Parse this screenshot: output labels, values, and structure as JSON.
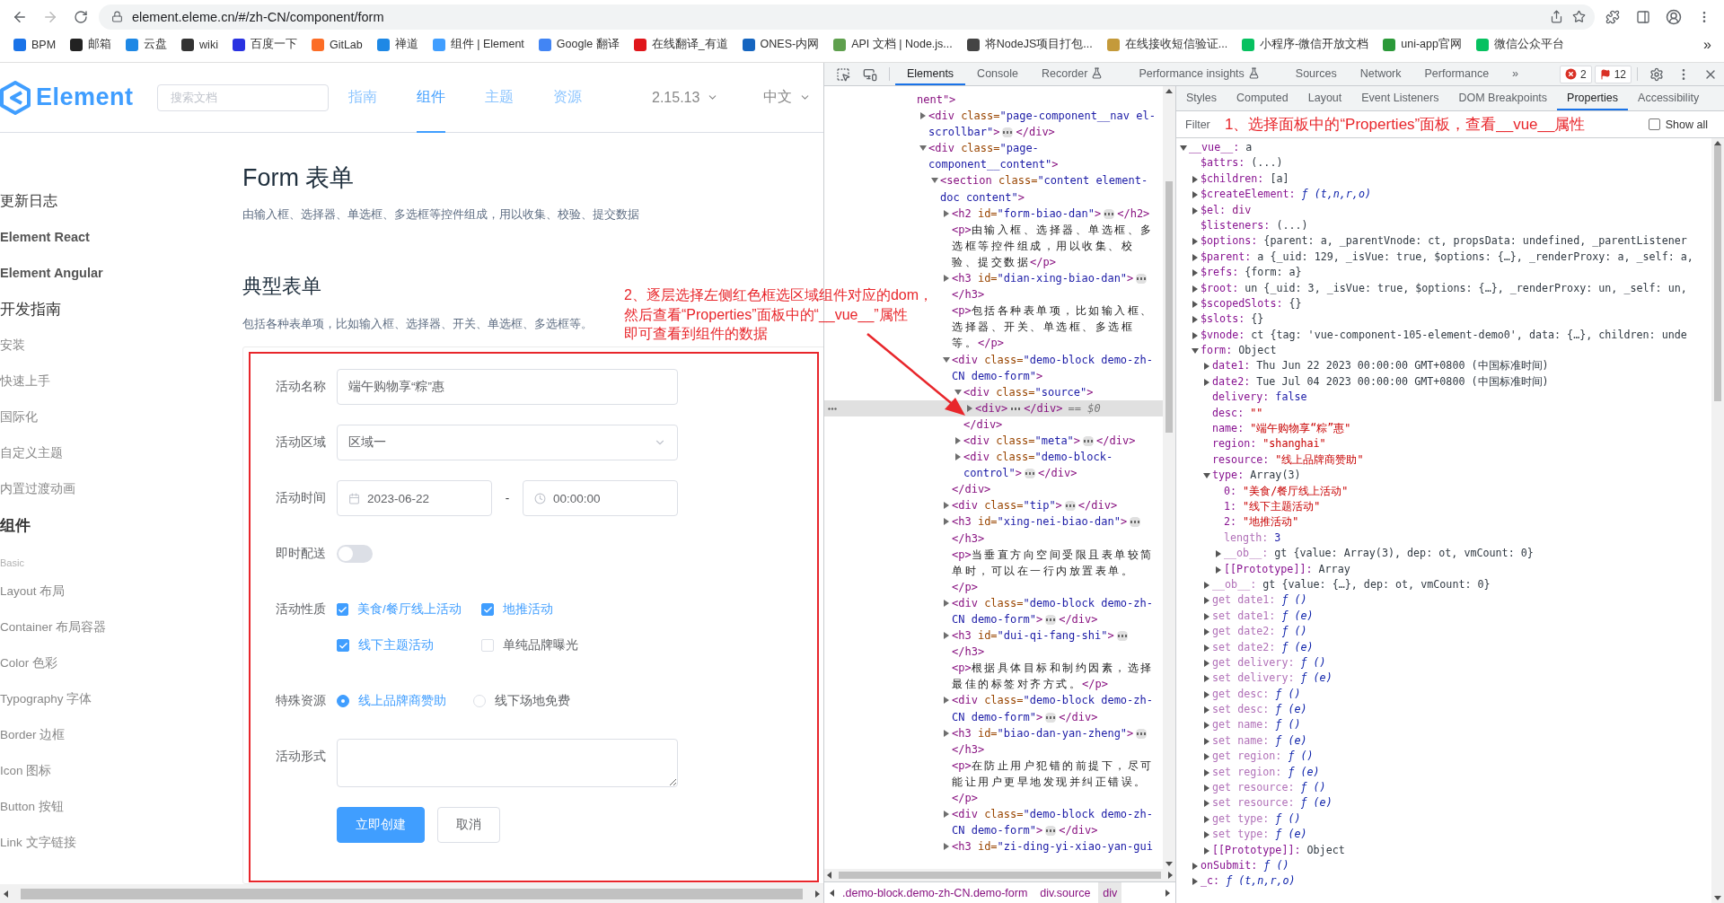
{
  "browser": {
    "url": "element.eleme.cn/#/zh-CN/component/form",
    "bookmarks": [
      {
        "label": "BPM",
        "color": "#1a73e8"
      },
      {
        "label": "邮箱",
        "color": "#222222"
      },
      {
        "label": "云盘",
        "color": "#1e88e5"
      },
      {
        "label": "wiki",
        "color": "#333333"
      },
      {
        "label": "百度一下",
        "color": "#2932e1"
      },
      {
        "label": "GitLab",
        "color": "#fc6d26"
      },
      {
        "label": "禅道",
        "color": "#1e88e5"
      },
      {
        "label": "组件 | Element",
        "color": "#409eff"
      },
      {
        "label": "Google 翻译",
        "color": "#4285f4"
      },
      {
        "label": "在线翻译_有道",
        "color": "#e0161b"
      },
      {
        "label": "ONES-内网",
        "color": "#1565c0"
      },
      {
        "label": "API 文档 | Node.js...",
        "color": "#5fa04e"
      },
      {
        "label": "将NodeJS项目打包...",
        "color": "#444444"
      },
      {
        "label": "在线接收短信验证...",
        "color": "#c49a3a"
      },
      {
        "label": "小程序-微信开放文档",
        "color": "#07c160"
      },
      {
        "label": "uni-app官网",
        "color": "#2b9939"
      },
      {
        "label": "微信公众平台",
        "color": "#07c160"
      }
    ],
    "more": "»"
  },
  "site": {
    "logo": "Element",
    "search": {
      "placeholder": "搜索文档"
    },
    "nav": [
      {
        "label": "指南",
        "selected": false
      },
      {
        "label": "组件",
        "selected": true
      },
      {
        "label": "主题",
        "selected": false
      },
      {
        "label": "资源",
        "selected": false
      }
    ],
    "version": "2.15.13",
    "language": "中文",
    "sidebar": [
      {
        "label": "更新日志",
        "kind": "top"
      },
      {
        "label": "Element React",
        "kind": "link"
      },
      {
        "label": "Element Angular",
        "kind": "link"
      },
      {
        "label": "开发指南",
        "kind": "section"
      },
      {
        "label": "安装",
        "kind": "item"
      },
      {
        "label": "快速上手",
        "kind": "item"
      },
      {
        "label": "国际化",
        "kind": "item"
      },
      {
        "label": "自定义主题",
        "kind": "item"
      },
      {
        "label": "内置过渡动画",
        "kind": "item"
      },
      {
        "label": "组件",
        "kind": "section"
      },
      {
        "label": "Basic",
        "kind": "group"
      },
      {
        "label": "Layout 布局",
        "kind": "item"
      },
      {
        "label": "Container 布局容器",
        "kind": "item"
      },
      {
        "label": "Color 色彩",
        "kind": "item"
      },
      {
        "label": "Typography 字体",
        "kind": "item"
      },
      {
        "label": "Border 边框",
        "kind": "item"
      },
      {
        "label": "Icon 图标",
        "kind": "item"
      },
      {
        "label": "Button 按钮",
        "kind": "item"
      },
      {
        "label": "Link 文字链接",
        "kind": "item"
      }
    ],
    "title": "Form 表单",
    "description": "由输入框、选择器、单选框、多选框等控件组成，用以收集、校验、提交数据",
    "section_title": "典型表单",
    "section_description": "包括各种表单项，比如输入框、选择器、开关、单选框、多选框等。",
    "form": {
      "fields": [
        {
          "label": "活动名称",
          "kind": "input",
          "value": "端午购物享“粽”惠"
        },
        {
          "label": "活动区域",
          "kind": "select",
          "value": "区域一"
        },
        {
          "label": "活动时间",
          "kind": "datetime",
          "date": "2023-06-22",
          "separator": "-",
          "time": "00:00:00"
        },
        {
          "label": "即时配送",
          "kind": "switch",
          "on": false
        },
        {
          "label": "活动性质",
          "kind": "checkboxes",
          "options": [
            {
              "label": "美食/餐厅线上活动",
              "checked": true
            },
            {
              "label": "地推活动",
              "checked": true
            },
            {
              "label": "线下主题活动",
              "checked": true
            },
            {
              "label": "单纯品牌曝光",
              "checked": false
            }
          ]
        },
        {
          "label": "特殊资源",
          "kind": "radios",
          "options": [
            {
              "label": "线上品牌商赞助",
              "selected": true
            },
            {
              "label": "线下场地免费",
              "selected": false
            }
          ]
        },
        {
          "label": "活动形式",
          "kind": "textarea"
        }
      ],
      "buttons": [
        {
          "label": "立即创建",
          "kind": "primary"
        },
        {
          "label": "取消",
          "kind": "default"
        }
      ]
    }
  },
  "annotation": {
    "lines": [
      "2、逐层选择左侧红色框选区域组件对应的dom，",
      "然后查看“Properties”面板中的“__vue__”属性",
      "即可查看到组件的数据"
    ]
  },
  "devtools": {
    "tabs": [
      {
        "label": "Elements",
        "selected": true,
        "experimental": false
      },
      {
        "label": "Console",
        "selected": false,
        "experimental": false
      },
      {
        "label": "Recorder",
        "selected": false,
        "experimental": true
      },
      {
        "label": "Performance insights",
        "selected": false,
        "experimental": true
      },
      {
        "label": "Sources",
        "selected": false,
        "experimental": false
      },
      {
        "label": "Network",
        "selected": false,
        "experimental": false
      },
      {
        "label": "Performance",
        "selected": false,
        "experimental": false
      }
    ],
    "more_tabs": "»",
    "errors": "2",
    "issues": "12",
    "elements": {
      "tree": [
        {
          "open": "nent\">",
          "selected": false,
          "children": [
            {
              "open": "<div class=\"page-component__nav el-scrollbar\">",
              "close": "</div>",
              "expanded": false,
              "selected": false
            },
            {
              "open": "<div class=\"page-component__content\">",
              "expanded": true,
              "selected": false,
              "children": [
                {
                  "open": "<section class=\"content element-doc content\">",
                  "expanded": true,
                  "selected": false,
                  "children": [
                    {
                      "open": "<h2 id=\"form-biao-dan\">",
                      "close": "</h2>",
                      "expanded": false,
                      "selected": false
                    },
                    {
                      "open": "<p>",
                      "text": "由输入框、选择器、单选框、多选框等控件组成，用以收集、校验、提交数据",
                      "close": "</p>",
                      "selected": false
                    },
                    {
                      "open": "<h3 id=\"dian-xing-biao-dan\">",
                      "close": "</h3>",
                      "expanded": false,
                      "selected": false
                    },
                    {
                      "open": "<p>",
                      "text": "包括各种表单项，比如输入框、选择器、开关、单选框、多选框等。",
                      "close": "</p>",
                      "selected": false
                    },
                    {
                      "open": "<div class=\"demo-block demo-zh-CN demo-form\">",
                      "close": "</div>",
                      "expanded": true,
                      "selected": false,
                      "children": [
                        {
                          "open": "<div class=\"source\">",
                          "close": "</div>",
                          "expanded": true,
                          "selected": false,
                          "children": [
                            {
                              "open": "<div>",
                              "close": "</div>",
                              "expanded": false,
                              "selected": true,
                              "suffix": "== $0"
                            }
                          ]
                        },
                        {
                          "open": "<div class=\"meta\">",
                          "close": "</div>",
                          "expanded": false,
                          "selected": false
                        },
                        {
                          "open": "<div class=\"demo-block-control\">",
                          "close": "</div>",
                          "expanded": false,
                          "selected": false
                        }
                      ]
                    },
                    {
                      "open": "<div class=\"tip\">",
                      "close": "</div>",
                      "expanded": false,
                      "selected": false
                    },
                    {
                      "open": "<h3 id=\"xing-nei-biao-dan\">",
                      "close": "</h3>",
                      "expanded": false,
                      "selected": false
                    },
                    {
                      "open": "<p>",
                      "text": "当垂直方向空间受限且表单较简单时，可以在一行内放置表单。",
                      "close": "</p>",
                      "selected": false
                    },
                    {
                      "open": "<div class=\"demo-block demo-zh-CN demo-form\">",
                      "close": "</div>",
                      "expanded": false,
                      "selected": false
                    },
                    {
                      "open": "<h3 id=\"dui-qi-fang-shi\">",
                      "close": "</h3>",
                      "expanded": false,
                      "selected": false
                    },
                    {
                      "open": "<p>",
                      "text": "根据具体目标和制约因素，选择最佳的标签对齐方式。",
                      "close": "</p>",
                      "selected": false
                    },
                    {
                      "open": "<div class=\"demo-block demo-zh-CN demo-form\">",
                      "close": "</div>",
                      "expanded": false,
                      "selected": false
                    },
                    {
                      "open": "<h3 id=\"biao-dan-yan-zheng\">",
                      "close": "</h3>",
                      "expanded": false,
                      "selected": false
                    },
                    {
                      "open": "<p>",
                      "text": "在防止用户犯错的前提下，尽可能让用户更早地发现并纠正错误。",
                      "close": "</p>",
                      "selected": false
                    },
                    {
                      "open": "<div class=\"demo-block demo-zh-CN demo-form\">",
                      "close": "</div>",
                      "expanded": false,
                      "selected": false
                    },
                    {
                      "open": "<h3 id=\"zi-ding-yi-xiao-yan-gui",
                      "expanded": false,
                      "selected": false
                    }
                  ]
                }
              ]
            }
          ]
        }
      ],
      "breadcrumbs": [
        {
          "label": ".demo-block.demo-zh-CN.demo-form",
          "selected": false
        },
        {
          "label": "div.source",
          "selected": false
        },
        {
          "label": "div",
          "selected": true
        }
      ]
    },
    "sidebar_tabs": [
      {
        "label": "Styles",
        "selected": false
      },
      {
        "label": "Computed",
        "selected": false
      },
      {
        "label": "Layout",
        "selected": false
      },
      {
        "label": "Event Listeners",
        "selected": false
      },
      {
        "label": "DOM Breakpoints",
        "selected": false
      },
      {
        "label": "Properties",
        "selected": true
      },
      {
        "label": "Accessibility",
        "selected": false
      }
    ],
    "filter": {
      "placeholder": "Filter",
      "note": "1、选择面板中的“Properties”面板，查看__vue__属性",
      "show_all": {
        "label": "Show all",
        "checked": false
      }
    },
    "properties": [
      {
        "key": "__vue__:",
        "value": "a",
        "kind": "object",
        "dim": false,
        "expanded": true,
        "children": [
          {
            "key": "$attrs:",
            "value": "(...)",
            "kind": "object",
            "dim": false
          },
          {
            "key": "$children:",
            "value": "[a]",
            "kind": "object",
            "dim": false,
            "expanded": false
          },
          {
            "key": "$createElement:",
            "value": "ƒ (t,n,r,o)",
            "kind": "function",
            "dim": false,
            "expanded": false
          },
          {
            "key": "$el:",
            "value": "div",
            "kind": "element",
            "dim": false,
            "expanded": false
          },
          {
            "key": "$listeners:",
            "value": "(...)",
            "kind": "object",
            "dim": false
          },
          {
            "key": "$options:",
            "value": "{parent: a, _parentVnode: ct, propsData: undefined, _parentListener",
            "kind": "object",
            "dim": false,
            "expanded": false
          },
          {
            "key": "$parent:",
            "value": "a {_uid: 129, _isVue: true, $options: {…}, _renderProxy: a, _self: a,",
            "kind": "object",
            "dim": false,
            "expanded": false
          },
          {
            "key": "$refs:",
            "value": "{form: a}",
            "kind": "object",
            "dim": false,
            "expanded": false
          },
          {
            "key": "$root:",
            "value": "un {_uid: 3, _isVue: true, $options: {…}, _renderProxy: un, _self: un,",
            "kind": "object",
            "dim": false,
            "expanded": false
          },
          {
            "key": "$scopedSlots:",
            "value": "{}",
            "kind": "object",
            "dim": false,
            "expanded": false
          },
          {
            "key": "$slots:",
            "value": "{}",
            "kind": "object",
            "dim": false,
            "expanded": false
          },
          {
            "key": "$vnode:",
            "value": "ct {tag: 'vue-component-105-element-demo0', data: {…}, children: unde",
            "kind": "object",
            "dim": false,
            "expanded": false
          },
          {
            "key": "form:",
            "value": "Object",
            "kind": "object",
            "dim": false,
            "expanded": true,
            "children": [
              {
                "key": "date1:",
                "value": "Thu Jun 22 2023 00:00:00 GMT+0800 (中国标准时间)",
                "kind": "object",
                "dim": false,
                "expanded": false
              },
              {
                "key": "date2:",
                "value": "Tue Jul 04 2023 00:00:00 GMT+0800 (中国标准时间)",
                "kind": "object",
                "dim": false,
                "expanded": false
              },
              {
                "key": "delivery:",
                "value": "false",
                "kind": "literal",
                "dim": false
              },
              {
                "key": "desc:",
                "value": "\"\"",
                "kind": "string",
                "dim": false
              },
              {
                "key": "name:",
                "value": "\"端午购物享“粽”惠\"",
                "kind": "string",
                "dim": false
              },
              {
                "key": "region:",
                "value": "\"shanghai\"",
                "kind": "string",
                "dim": false
              },
              {
                "key": "resource:",
                "value": "\"线上品牌商赞助\"",
                "kind": "string",
                "dim": false
              },
              {
                "key": "type:",
                "value": "Array(3)",
                "kind": "object",
                "dim": false,
                "expanded": true,
                "children": [
                  {
                    "key": "0:",
                    "value": "\"美食/餐厅线上活动\"",
                    "kind": "string",
                    "dim": false
                  },
                  {
                    "key": "1:",
                    "value": "\"线下主题活动\"",
                    "kind": "string",
                    "dim": false
                  },
                  {
                    "key": "2:",
                    "value": "\"地推活动\"",
                    "kind": "string",
                    "dim": false
                  },
                  {
                    "key": "length:",
                    "value": "3",
                    "kind": "literal",
                    "dim": true
                  },
                  {
                    "key": "__ob__:",
                    "value": "gt {value: Array(3), dep: ot, vmCount: 0}",
                    "kind": "object",
                    "dim": true,
                    "expanded": false
                  },
                  {
                    "key": "[[Prototype]]:",
                    "value": "Array",
                    "kind": "object",
                    "dim": false,
                    "expanded": false
                  }
                ]
              },
              {
                "key": "__ob__:",
                "value": "gt {value: {…}, dep: ot, vmCount: 0}",
                "kind": "object",
                "dim": true,
                "expanded": false
              },
              {
                "key": "get date1:",
                "value": "ƒ ()",
                "kind": "function",
                "dim": true,
                "expanded": false
              },
              {
                "key": "set date1:",
                "value": "ƒ (e)",
                "kind": "function",
                "dim": true,
                "expanded": false
              },
              {
                "key": "get date2:",
                "value": "ƒ ()",
                "kind": "function",
                "dim": true,
                "expanded": false
              },
              {
                "key": "set date2:",
                "value": "ƒ (e)",
                "kind": "function",
                "dim": true,
                "expanded": false
              },
              {
                "key": "get delivery:",
                "value": "ƒ ()",
                "kind": "function",
                "dim": true,
                "expanded": false
              },
              {
                "key": "set delivery:",
                "value": "ƒ (e)",
                "kind": "function",
                "dim": true,
                "expanded": false
              },
              {
                "key": "get desc:",
                "value": "ƒ ()",
                "kind": "function",
                "dim": true,
                "expanded": false
              },
              {
                "key": "set desc:",
                "value": "ƒ (e)",
                "kind": "function",
                "dim": true,
                "expanded": false
              },
              {
                "key": "get name:",
                "value": "ƒ ()",
                "kind": "function",
                "dim": true,
                "expanded": false
              },
              {
                "key": "set name:",
                "value": "ƒ (e)",
                "kind": "function",
                "dim": true,
                "expanded": false
              },
              {
                "key": "get region:",
                "value": "ƒ ()",
                "kind": "function",
                "dim": true,
                "expanded": false
              },
              {
                "key": "set region:",
                "value": "ƒ (e)",
                "kind": "function",
                "dim": true,
                "expanded": false
              },
              {
                "key": "get resource:",
                "value": "ƒ ()",
                "kind": "function",
                "dim": true,
                "expanded": false
              },
              {
                "key": "set resource:",
                "value": "ƒ (e)",
                "kind": "function",
                "dim": true,
                "expanded": false
              },
              {
                "key": "get type:",
                "value": "ƒ ()",
                "kind": "function",
                "dim": true,
                "expanded": false
              },
              {
                "key": "set type:",
                "value": "ƒ (e)",
                "kind": "function",
                "dim": true,
                "expanded": false
              },
              {
                "key": "[[Prototype]]:",
                "value": "Object",
                "kind": "object",
                "dim": false,
                "expanded": false
              }
            ]
          },
          {
            "key": "onSubmit:",
            "value": "ƒ ()",
            "kind": "function",
            "dim": false,
            "expanded": false
          },
          {
            "key": "_c:",
            "value": "ƒ (t,n,r,o)",
            "kind": "function",
            "dim": false,
            "expanded": false
          }
        ]
      }
    ]
  }
}
